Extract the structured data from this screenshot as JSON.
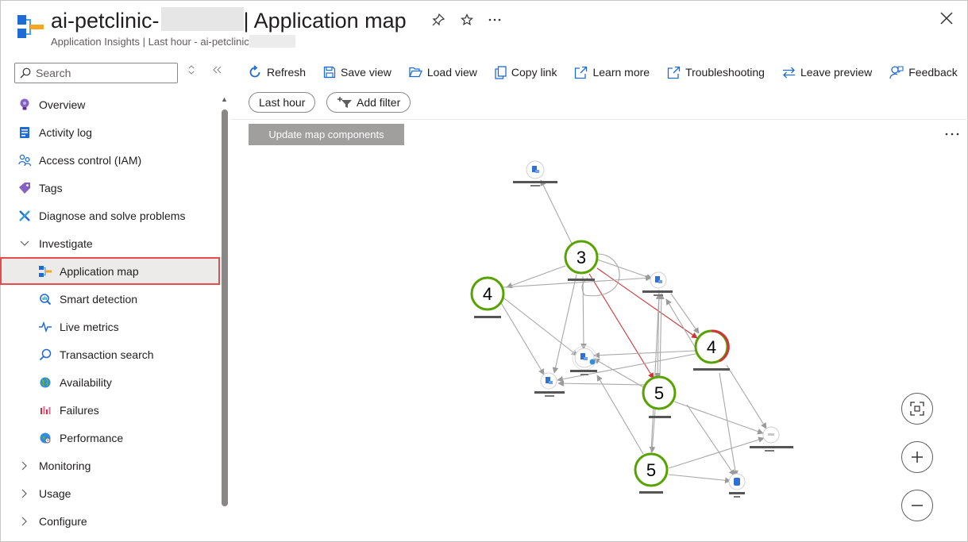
{
  "header": {
    "title_prefix": "ai-petclinic-",
    "title_suffix": "| Application map",
    "subtitle": "Application Insights | Last hour - ai-petclinic",
    "icons": [
      "pin-icon",
      "star-icon",
      "more-icon",
      "close-icon"
    ]
  },
  "sidebar": {
    "search_placeholder": "Search",
    "items": [
      {
        "label": "Overview",
        "icon": "overview-bulb-icon"
      },
      {
        "label": "Activity log",
        "icon": "activity-log-icon"
      },
      {
        "label": "Access control (IAM)",
        "icon": "iam-people-icon"
      },
      {
        "label": "Tags",
        "icon": "tag-icon"
      },
      {
        "label": "Diagnose and solve problems",
        "icon": "wrench-icon"
      },
      {
        "label": "Investigate",
        "icon": "chevron-down-icon"
      },
      {
        "label": "Application map",
        "icon": "app-map-icon"
      },
      {
        "label": "Smart detection",
        "icon": "smart-detection-icon"
      },
      {
        "label": "Live metrics",
        "icon": "live-metrics-icon"
      },
      {
        "label": "Transaction search",
        "icon": "search-icon"
      },
      {
        "label": "Availability",
        "icon": "globe-icon"
      },
      {
        "label": "Failures",
        "icon": "failures-icon"
      },
      {
        "label": "Performance",
        "icon": "performance-icon"
      },
      {
        "label": "Monitoring",
        "icon": "chevron-right-icon"
      },
      {
        "label": "Usage",
        "icon": "chevron-right-icon"
      },
      {
        "label": "Configure",
        "icon": "chevron-right-icon"
      }
    ]
  },
  "toolbar": {
    "refresh": "Refresh",
    "save_view": "Save view",
    "load_view": "Load view",
    "copy_link": "Copy link",
    "learn_more": "Learn more",
    "troubleshooting": "Troubleshooting",
    "leave_preview": "Leave preview",
    "feedback": "Feedback"
  },
  "filters": {
    "time_range": "Last hour",
    "add_filter": "Add filter"
  },
  "update_button": "Update map components",
  "map": {
    "nodes": [
      {
        "id": "admin-server",
        "count": "3",
        "status": "healthy"
      },
      {
        "id": "api-gateway",
        "count": "4",
        "status": "healthy"
      },
      {
        "id": "customers-service",
        "count": "4",
        "status": "failing"
      },
      {
        "id": "vets-service",
        "count": "5",
        "status": "healthy"
      },
      {
        "id": "visits-service",
        "count": "5",
        "status": "healthy"
      }
    ],
    "colors": {
      "healthy": "#57a300",
      "failing": "#d13438",
      "edge": "#a8a8a8",
      "edge_error": "#d13438"
    }
  }
}
